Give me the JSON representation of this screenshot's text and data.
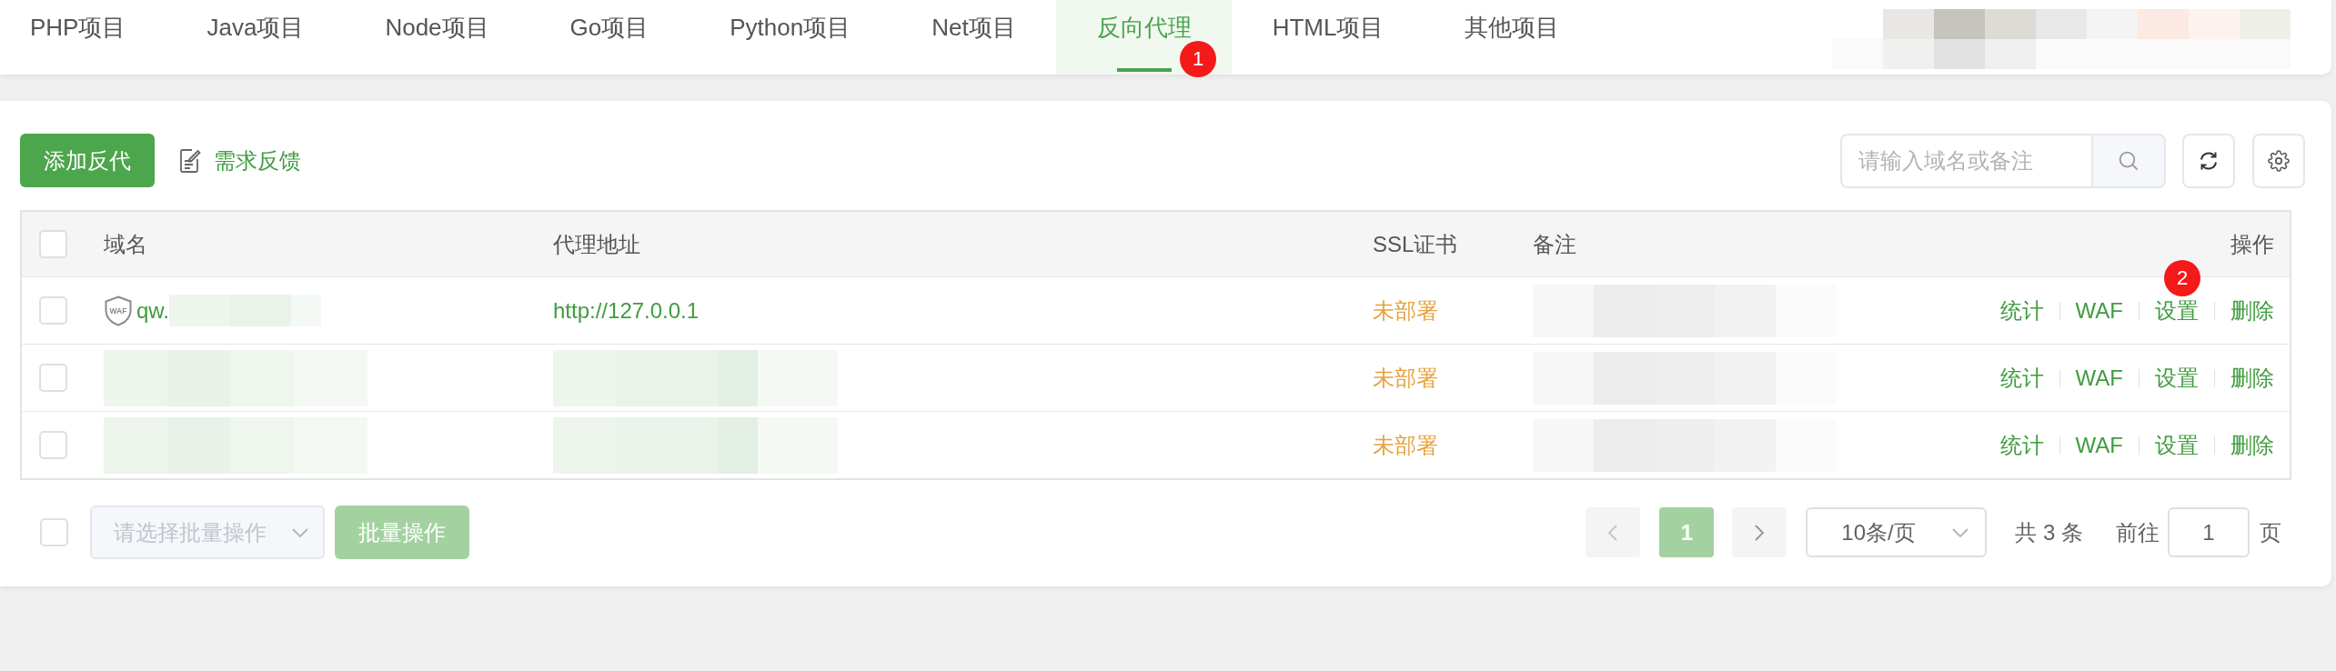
{
  "tabs": [
    {
      "label": "PHP项目",
      "selected": false
    },
    {
      "label": "Java项目",
      "selected": false
    },
    {
      "label": "Node项目",
      "selected": false
    },
    {
      "label": "Go项目",
      "selected": false
    },
    {
      "label": "Python项目",
      "selected": false
    },
    {
      "label": "Net项目",
      "selected": false
    },
    {
      "label": "反向代理",
      "selected": true,
      "annotation": "1"
    },
    {
      "label": "HTML项目",
      "selected": false
    },
    {
      "label": "其他项目",
      "selected": false
    }
  ],
  "header_redacted": true,
  "toolbar": {
    "add_button": "添加反代",
    "feedback_link": "需求反馈",
    "search": {
      "placeholder": "请输入域名或备注"
    }
  },
  "table": {
    "select_all": {
      "checked": false
    },
    "columns": [
      "域名",
      "代理地址",
      "SSL证书",
      "备注",
      "操作"
    ],
    "rows": [
      {
        "checked": false,
        "shield": "WAF",
        "domain": "qw.",
        "domain_redacted": true,
        "proxy": "http://127.0.0.1",
        "ssl": "未部署",
        "note_redacted": true,
        "actions": [
          {
            "label": "统计"
          },
          {
            "label": "WAF"
          },
          {
            "label": "设置",
            "annotation": "2"
          },
          {
            "label": "删除"
          }
        ]
      },
      {
        "checked": false,
        "domain_redacted": true,
        "proxy_redacted": true,
        "ssl": "未部署",
        "note_redacted": true,
        "actions": [
          {
            "label": "统计"
          },
          {
            "label": "WAF"
          },
          {
            "label": "设置"
          },
          {
            "label": "删除"
          }
        ]
      },
      {
        "checked": false,
        "domain_redacted": true,
        "proxy_redacted": true,
        "ssl": "未部署",
        "note_redacted": true,
        "actions": [
          {
            "label": "统计"
          },
          {
            "label": "WAF"
          },
          {
            "label": "设置"
          },
          {
            "label": "删除"
          }
        ]
      }
    ]
  },
  "footer": {
    "select_all": {
      "checked": false
    },
    "batch_select": {
      "placeholder": "请选择批量操作",
      "disabled": true
    },
    "batch_button": {
      "label": "批量操作",
      "disabled": true
    },
    "pagination": {
      "prev_disabled": true,
      "pages": [
        {
          "label": "1",
          "selected": true
        }
      ],
      "next_disabled": false,
      "page_size": "10条/页",
      "total": "共 3 条",
      "goto_label": "前往",
      "goto_value": "1",
      "page_suffix": "页"
    }
  }
}
